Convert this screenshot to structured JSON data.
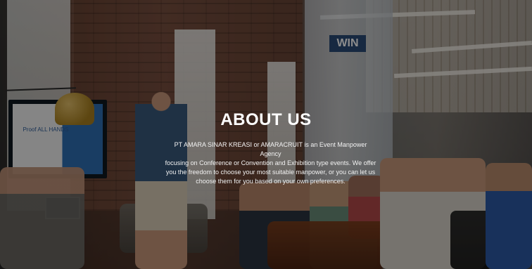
{
  "hero": {
    "title": "ABOUT US",
    "description_lines": [
      "PT AMARA SINAR KREASI or AMARACRUIT is an Event Manpower Agency",
      "focusing on Conference or Convention and Exhibition type events. We offer",
      "you the freedom to choose your most suitable manpower, or you can let us",
      "choose them for you based on your own preferences."
    ]
  },
  "background": {
    "pillar_sign": "WIN",
    "screen_text": "Proof\nALL HANDS",
    "colors": {
      "overlay": "#000000",
      "title": "#ffffff",
      "text": "#f2f2f2"
    }
  }
}
